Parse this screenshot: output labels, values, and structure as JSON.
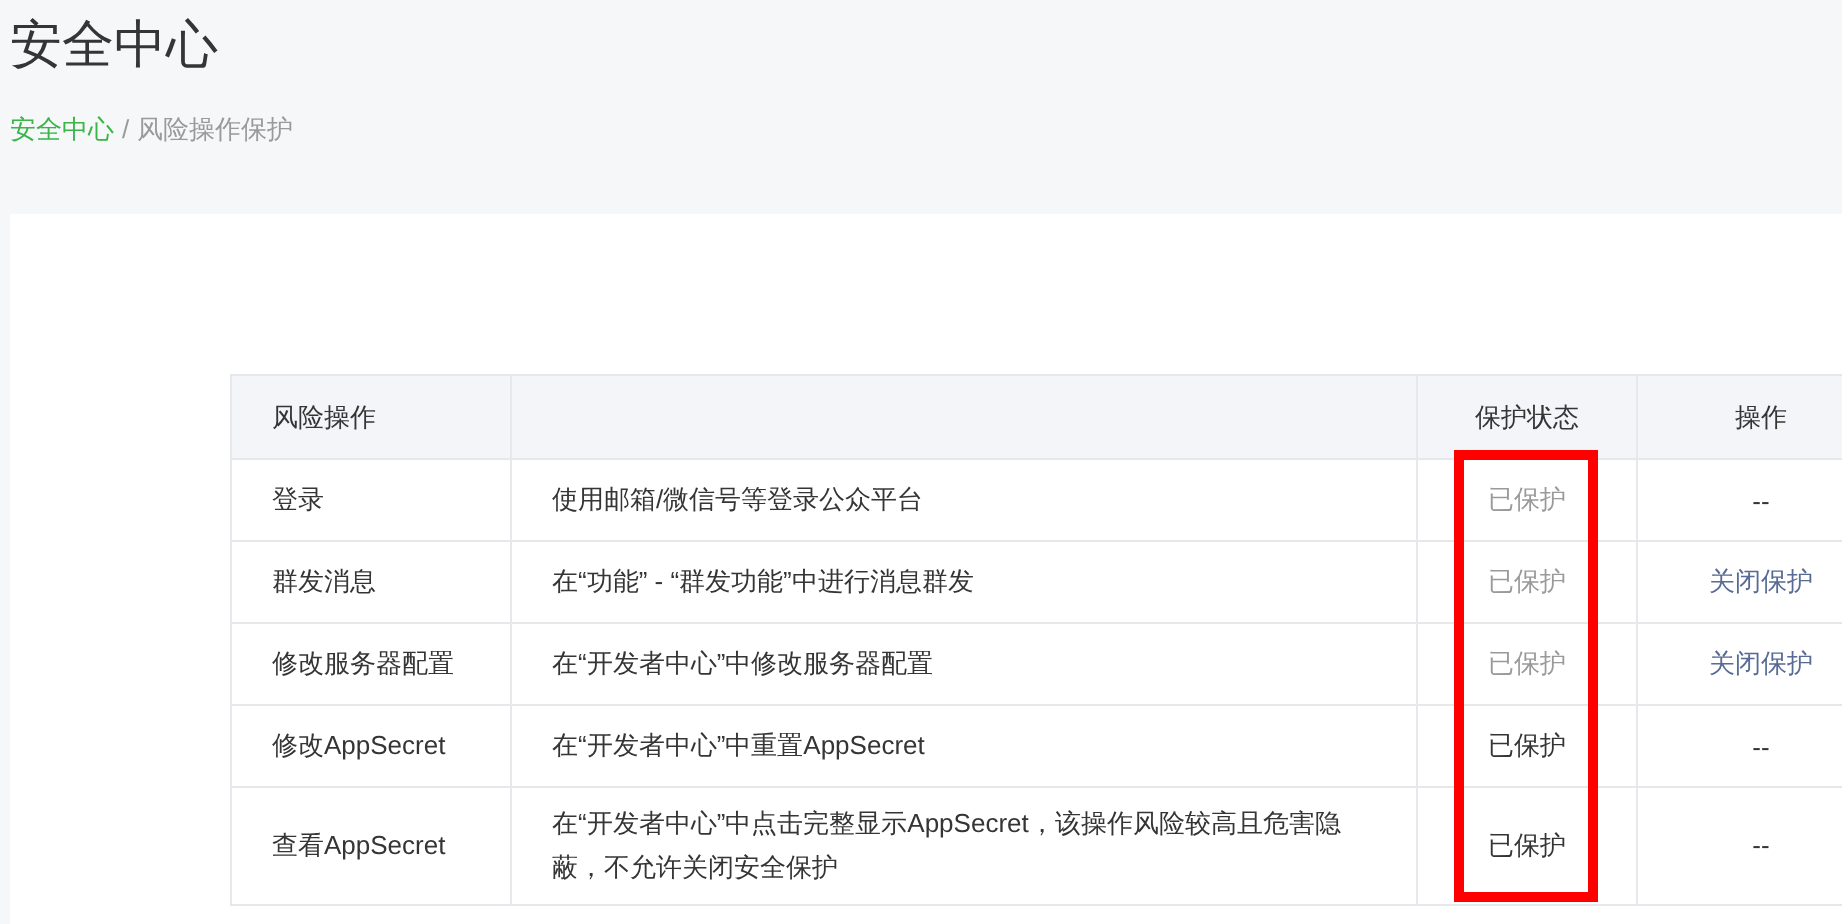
{
  "page_title": "安全中心",
  "breadcrumb": [
    {
      "label": "安全中心",
      "kind": "link"
    },
    {
      "label": "风险操作保护",
      "kind": "current"
    }
  ],
  "breadcrumb_separator": "/",
  "table": {
    "columns": [
      "风险操作",
      "",
      "保护状态",
      "操作"
    ],
    "rows": [
      {
        "operation": "登录",
        "description": "使用邮箱/微信号等登录公众平台",
        "status": {
          "label": "已保护",
          "muted": true
        },
        "action": {
          "kind": "none",
          "label": "--"
        }
      },
      {
        "operation": "群发消息",
        "description": "在“功能” - “群发功能”中进行消息群发",
        "status": {
          "label": "已保护",
          "muted": true
        },
        "action": {
          "kind": "link",
          "label": "关闭保护"
        }
      },
      {
        "operation": "修改服务器配置",
        "description": "在“开发者中心”中修改服务器配置",
        "status": {
          "label": "已保护",
          "muted": true
        },
        "action": {
          "kind": "link",
          "label": "关闭保护"
        }
      },
      {
        "operation": "修改AppSecret",
        "description": "在“开发者中心”中重置AppSecret",
        "status": {
          "label": "已保护",
          "muted": false
        },
        "action": {
          "kind": "none",
          "label": "--"
        }
      },
      {
        "operation": "查看AppSecret",
        "description": "在“开发者中心”中点击完整显示AppSecret，该操作风险较高且危害隐蔽，不允许关闭安全保护",
        "status": {
          "label": "已保护",
          "muted": false
        },
        "action": {
          "kind": "none",
          "label": "--"
        }
      }
    ]
  },
  "status_column_highlighted": true
}
